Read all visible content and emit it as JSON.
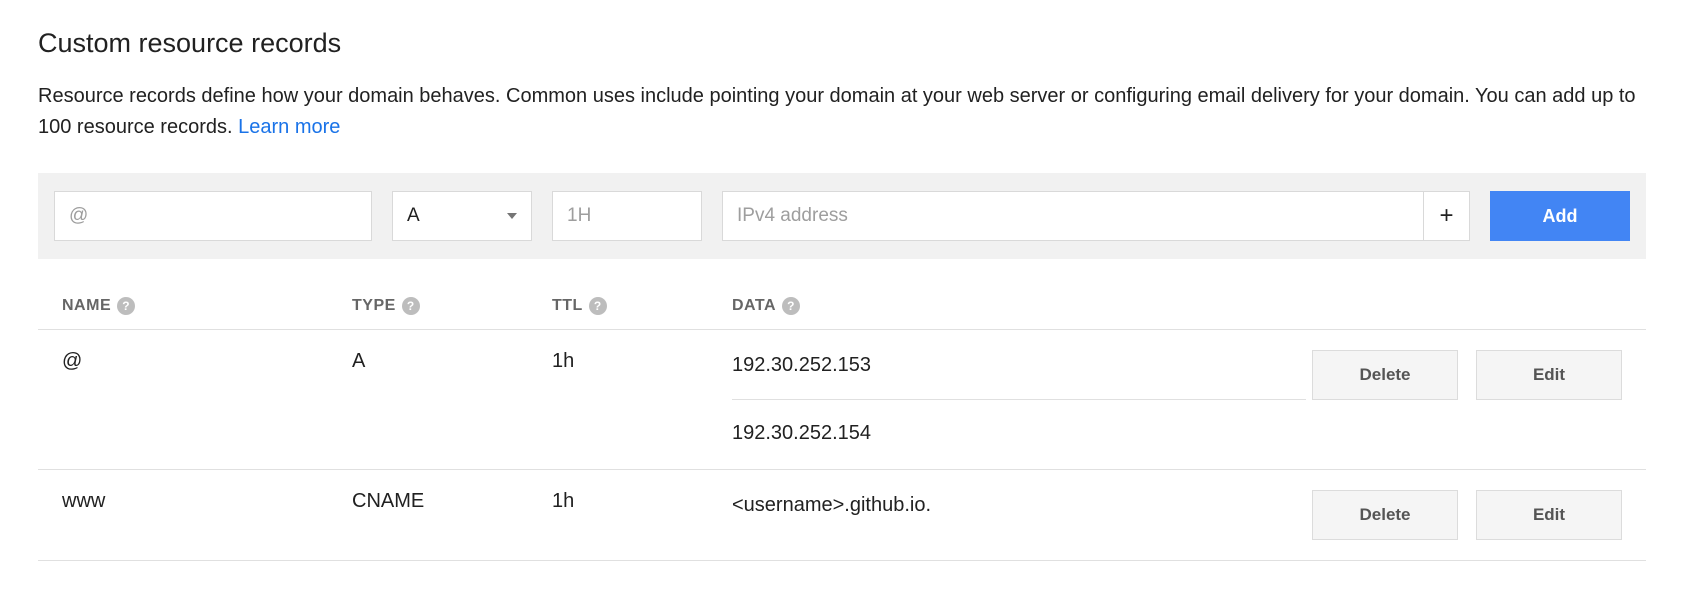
{
  "heading": "Custom resource records",
  "description": "Resource records define how your domain behaves. Common uses include pointing your domain at your web server or configuring email delivery for your domain. You can add up to 100 resource records. ",
  "learn_more": "Learn more",
  "form": {
    "name_placeholder": "@",
    "type_selected": "A",
    "ttl_placeholder": "1H",
    "data_placeholder": "IPv4 address",
    "plus_label": "+",
    "add_label": "Add"
  },
  "columns": {
    "name": "NAME",
    "type": "TYPE",
    "ttl": "TTL",
    "data": "DATA",
    "help": "?"
  },
  "rows": [
    {
      "name": "@",
      "type": "A",
      "ttl": "1h",
      "data": [
        "192.30.252.153",
        "192.30.252.154"
      ]
    },
    {
      "name": "www",
      "type": "CNAME",
      "ttl": "1h",
      "data": [
        "<username>.github.io."
      ]
    }
  ],
  "actions": {
    "delete": "Delete",
    "edit": "Edit"
  }
}
